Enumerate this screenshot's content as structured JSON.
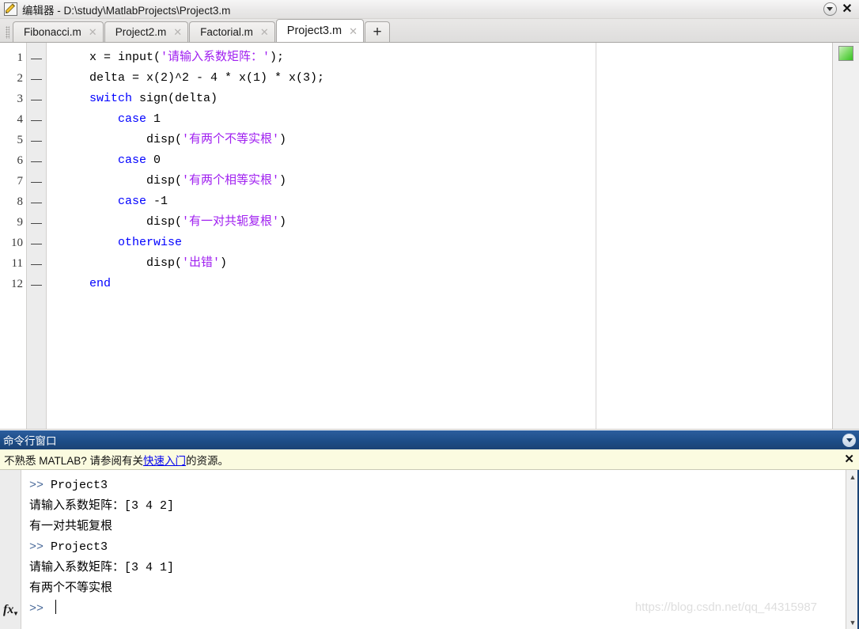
{
  "window": {
    "title": "编辑器 - D:\\study\\MatlabProjects\\Project3.m",
    "icon": "editor-pencil-icon",
    "dropdown_label": "▼",
    "close_label": "✕"
  },
  "tabs": {
    "items": [
      {
        "label": "Fibonacci.m",
        "close": "✕",
        "active": false
      },
      {
        "label": "Project2.m",
        "close": "✕",
        "active": false
      },
      {
        "label": "Factorial.m",
        "close": "✕",
        "active": false
      },
      {
        "label": "Project3.m",
        "close": "✕",
        "active": true
      }
    ],
    "add_label": "+"
  },
  "editor": {
    "line_numbers": [
      "1",
      "2",
      "3",
      "4",
      "5",
      "6",
      "7",
      "8",
      "9",
      "10",
      "11",
      "12"
    ],
    "exec_marks": [
      "—",
      "—",
      "—",
      "—",
      "—",
      "—",
      "—",
      "—",
      "—",
      "—",
      "—",
      "—"
    ],
    "lines": [
      {
        "n": 1,
        "text": "    x = input('请输入系数矩阵：');"
      },
      {
        "n": 2,
        "text": "    delta = x(2)^2 - 4 * x(1) * x(3);"
      },
      {
        "n": 3,
        "text": "    switch sign(delta)"
      },
      {
        "n": 4,
        "text": "        case 1"
      },
      {
        "n": 5,
        "text": "            disp('有两个不等实根')"
      },
      {
        "n": 6,
        "text": "        case 0"
      },
      {
        "n": 7,
        "text": "            disp('有两个相等实根')"
      },
      {
        "n": 8,
        "text": "        case -1"
      },
      {
        "n": 9,
        "text": "            disp('有一对共轭复根')"
      },
      {
        "n": 10,
        "text": "        otherwise"
      },
      {
        "n": 11,
        "text": "            disp('出错')"
      },
      {
        "n": 12,
        "text": "    end"
      }
    ],
    "health_indicator_color": "#36c221"
  },
  "command_window": {
    "title": "命令行窗口",
    "dropdown_label": "▼",
    "notice": {
      "text_before": "不熟悉 MATLAB? 请参阅有关",
      "link": "快速入门",
      "text_after": "的资源。",
      "close": "✕"
    },
    "fx_icon": "fx",
    "output": [
      {
        "prompt": ">> ",
        "text": "Project3"
      },
      {
        "prompt": "",
        "text": "请输入系数矩阵：[3 4 2]"
      },
      {
        "prompt": "",
        "text": "有一对共轭复根"
      },
      {
        "prompt": ">> ",
        "text": "Project3"
      },
      {
        "prompt": "",
        "text": "请输入系数矩阵：[3 4 1]"
      },
      {
        "prompt": "",
        "text": "有两个不等实根"
      }
    ],
    "current_prompt": ">> ",
    "scrollbar": {
      "up": "▲",
      "down": "▼"
    }
  },
  "watermark": "https://blog.csdn.net/qq_44315987",
  "colors": {
    "keyword": "#0000ff",
    "string": "#a020f0",
    "prompt": "#4a6a9a",
    "header_blue": "#1d4d88",
    "notice_bg": "#fbfbe0",
    "link": "#0000ee"
  }
}
